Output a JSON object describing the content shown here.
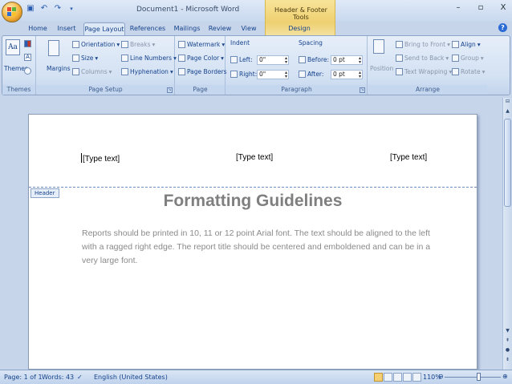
{
  "window": {
    "title": "Document1 - Microsoft Word",
    "contextual_tab_group": "Header & Footer Tools",
    "controls": {
      "minimize": "–",
      "restore": "▫",
      "close": "X"
    }
  },
  "tabs": [
    "Home",
    "Insert",
    "Page Layout",
    "References",
    "Mailings",
    "Review",
    "View",
    "Design"
  ],
  "active_tab": "Page Layout",
  "ribbon": {
    "themes": {
      "label": "Themes",
      "themes_btn": "Themes"
    },
    "page_setup": {
      "label": "Page Setup",
      "margins": "Margins",
      "orientation": "Orientation",
      "size": "Size",
      "columns": "Columns",
      "breaks": "Breaks",
      "line_numbers": "Line Numbers",
      "hyphenation": "Hyphenation"
    },
    "page_background": {
      "label": "Page Background",
      "watermark": "Watermark",
      "page_color": "Page Color",
      "page_borders": "Page Borders"
    },
    "paragraph": {
      "label": "Paragraph",
      "indent_header": "Indent",
      "left_label": "Left:",
      "left_value": "0\"",
      "right_label": "Right:",
      "right_value": "0\"",
      "spacing_header": "Spacing",
      "before_label": "Before:",
      "before_value": "0 pt",
      "after_label": "After:",
      "after_value": "0 pt"
    },
    "arrange": {
      "label": "Arrange",
      "position": "Position",
      "bring_to_front": "Bring to Front",
      "send_to_back": "Send to Back",
      "text_wrapping": "Text Wrapping",
      "align": "Align",
      "group": "Group",
      "rotate": "Rotate"
    }
  },
  "document": {
    "header_placeholders": [
      "[Type text]",
      "[Type text]",
      "[Type text]"
    ],
    "header_tag": "Header",
    "title": "Formatting Guidelines",
    "body": "Reports should be printed in 10, 11 or 12 point Arial font. The text should be aligned to the left with a ragged right edge. The report title should be centered and emboldened and can be in a very large font."
  },
  "status": {
    "page": "Page: 1 of 1",
    "words": "Words: 43",
    "language": "English (United States)",
    "zoom": "110%"
  }
}
